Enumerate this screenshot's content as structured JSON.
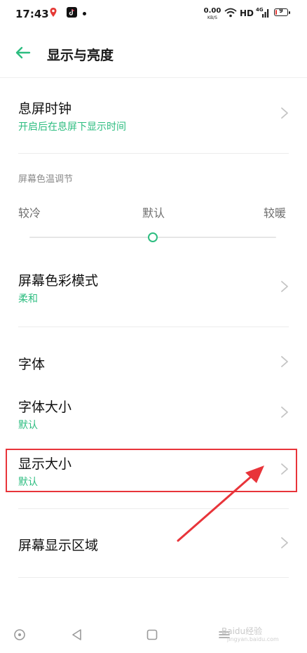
{
  "status_bar": {
    "time": "17:43",
    "net_speed_value": "0.00",
    "net_speed_unit": "KB/S",
    "hd": "HD",
    "signal_type": "4G",
    "battery_level_percent": 9,
    "battery_text": "9",
    "battery_color": "#e53935"
  },
  "header": {
    "title": "显示与亮度",
    "back_icon": "back-arrow-icon"
  },
  "accent_color": "#2dbd80",
  "settings": {
    "aod_clock": {
      "title": "息屏时钟",
      "subtitle": "开启后在息屏下显示时间"
    },
    "color_temp": {
      "section_label": "屏幕色温调节",
      "cold": "较冷",
      "default": "默认",
      "warm": "较暖",
      "slider_value": 0.5
    },
    "color_mode": {
      "title": "屏幕色彩模式",
      "subtitle": "柔和"
    },
    "font": {
      "title": "字体"
    },
    "font_size": {
      "title": "字体大小",
      "subtitle": "默认"
    },
    "display_size": {
      "title": "显示大小",
      "subtitle": "默认"
    },
    "screen_area": {
      "title": "屏幕显示区域"
    }
  },
  "annotation": {
    "highlight_color": "#e8343a"
  },
  "nav_bar": {
    "icons": [
      "assistant-circle-icon",
      "back-triangle-icon",
      "home-square-icon",
      "menu-lines-icon"
    ]
  },
  "watermark": {
    "text": "Baidu经验",
    "sub": "jingyan.baidu.com"
  }
}
